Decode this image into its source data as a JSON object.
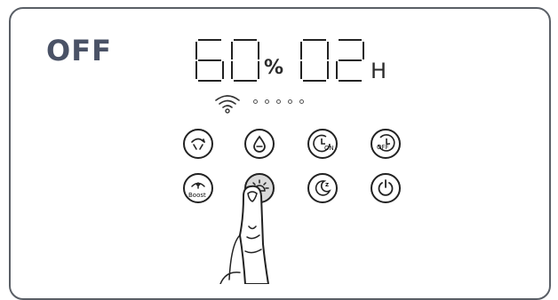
{
  "display": {
    "status": "OFF",
    "humidity_digits": "60",
    "humidity_unit": "%",
    "timer_digits": "02",
    "timer_unit": "H",
    "wifi_icon": "wifi-icon",
    "level_dots": 5
  },
  "buttons": [
    {
      "name": "mode-button",
      "icon": "mode-arrows-icon"
    },
    {
      "name": "humidity-button",
      "icon": "water-drop-icon"
    },
    {
      "name": "timer-on-button",
      "icon": "clock-on-icon",
      "label": "ON"
    },
    {
      "name": "timer-off-button",
      "icon": "clock-off-icon",
      "label": "OFF"
    },
    {
      "name": "boost-button",
      "icon": "boost-fan-icon",
      "label": "Boost"
    },
    {
      "name": "light-button",
      "icon": "light-icon",
      "active": true
    },
    {
      "name": "sleep-button",
      "icon": "moon-z-icon",
      "label": "z"
    },
    {
      "name": "power-button",
      "icon": "power-icon"
    }
  ],
  "colors": {
    "status_text": "#4a5266",
    "outline": "#222222",
    "pressed_fill": "#d9d9d9"
  }
}
